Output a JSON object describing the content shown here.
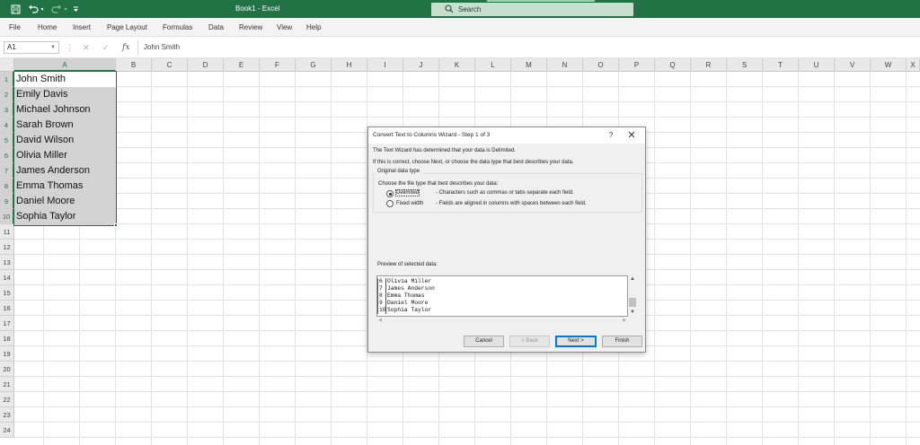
{
  "app": {
    "title": "Book1  -  Excel",
    "search_placeholder": "Search",
    "accent_color": "#217346"
  },
  "quick_access": {
    "icons": [
      "save-icon",
      "undo-icon",
      "undo-dropdown-icon",
      "redo-icon",
      "redo-dropdown-icon",
      "customize-qat-icon"
    ]
  },
  "ribbon": {
    "tabs": [
      "File",
      "Home",
      "Insert",
      "Page Layout",
      "Formulas",
      "Data",
      "Review",
      "View",
      "Help"
    ]
  },
  "formula_bar": {
    "name_box": "A1",
    "formula": "John Smith"
  },
  "grid": {
    "columns": [
      "A",
      "B",
      "C",
      "D",
      "E",
      "F",
      "G",
      "H",
      "I",
      "J",
      "K",
      "L",
      "M",
      "N",
      "O",
      "P",
      "Q",
      "R",
      "S",
      "T",
      "U",
      "V",
      "W",
      "X"
    ],
    "rows": [
      "1",
      "2",
      "3",
      "4",
      "5",
      "6",
      "7",
      "8",
      "9",
      "10",
      "11",
      "12",
      "13",
      "14",
      "15",
      "16",
      "17",
      "18",
      "19",
      "20",
      "21",
      "22",
      "23",
      "24"
    ],
    "column_a_values": [
      "John Smith",
      "Emily Davis",
      "Michael Johnson",
      "Sarah Brown",
      "David Wilson",
      "Olivia Miller",
      "James Anderson",
      "Emma Thomas",
      "Daniel Moore",
      "Sophia Taylor"
    ],
    "selected_range": "A1:A10"
  },
  "dialog": {
    "title": "Convert Text to Columns Wizard - Step 1 of 3",
    "help_glyph": "?",
    "close_glyph": "✕",
    "intro_line1": "The Text Wizard has determined that your data is Delimited.",
    "intro_line2": "If this is correct, choose Next, or choose the data type that best describes your data.",
    "group_label": "Original data type",
    "choose_label": "Choose the file type that best describes your data:",
    "options": [
      {
        "label": "Delimited",
        "desc": "- Characters such as commas or tabs separate each field.",
        "selected": true
      },
      {
        "label": "Fixed width",
        "desc": "- Fields are aligned in columns with spaces between each field.",
        "selected": false
      }
    ],
    "preview_label": "Preview of selected data:",
    "preview_rows": [
      {
        "num": "6",
        "text": "Olivia Miller"
      },
      {
        "num": "7",
        "text": "James Anderson"
      },
      {
        "num": "8",
        "text": "Emma Thomas"
      },
      {
        "num": "9",
        "text": "Daniel Moore"
      },
      {
        "num": "10",
        "text": "Sophia Taylor"
      }
    ],
    "buttons": {
      "cancel": "Cancel",
      "back": "< Back",
      "next": "Next >",
      "finish": "Finish"
    }
  }
}
